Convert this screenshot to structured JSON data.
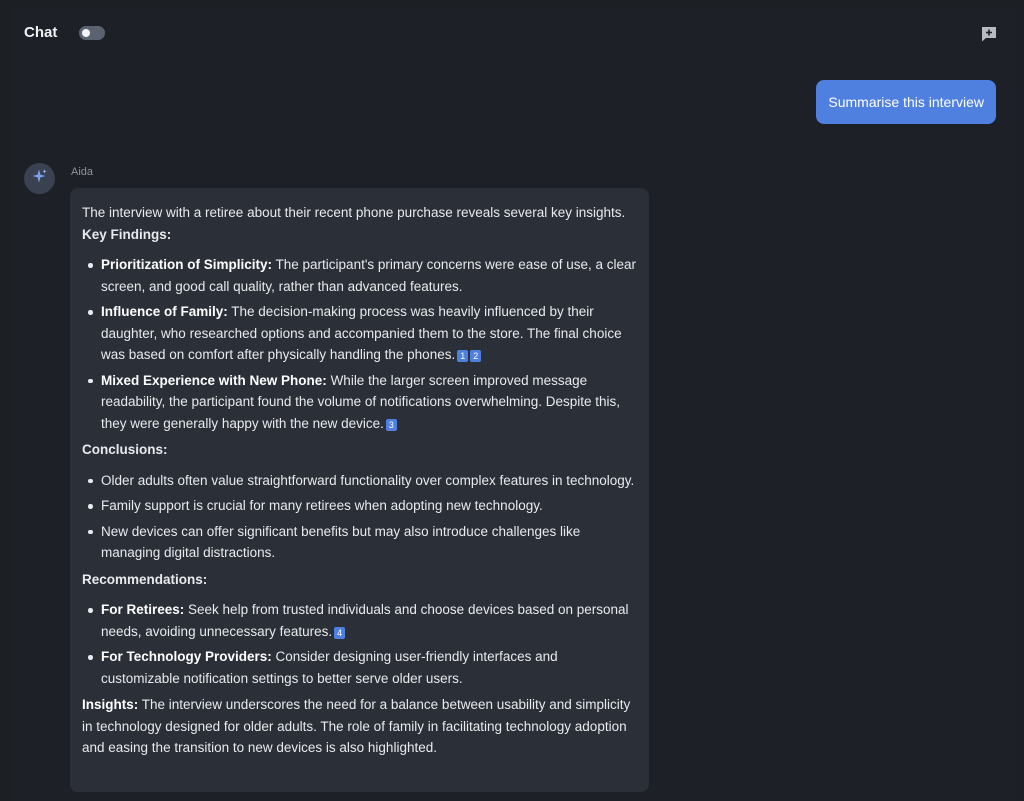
{
  "header": {
    "title": "Chat"
  },
  "user_message": "Summarise this interview",
  "assistant": {
    "name": "Aida",
    "intro": "The interview with a retiree about their recent phone purchase reveals several key insights.",
    "key_findings_title": "Key Findings:",
    "key_findings": [
      {
        "title": "Prioritization of Simplicity:",
        "text": " The participant's primary concerns were ease of use, a clear screen, and good call quality, rather than advanced features.",
        "citations": []
      },
      {
        "title": "Influence of Family:",
        "text": " The decision-making process was heavily influenced by their daughter, who researched options and accompanied them to the store. The final choice was based on comfort after physically handling the phones.",
        "citations": [
          "1",
          "2"
        ]
      },
      {
        "title": "Mixed Experience with New Phone:",
        "text": " While the larger screen improved message readability, the participant found the volume of notifications overwhelming. Despite this, they were generally happy with the new device.",
        "citations": [
          "3"
        ]
      }
    ],
    "conclusions_title": "Conclusions:",
    "conclusions": [
      "Older adults often value straightforward functionality over complex features in technology.",
      "Family support is crucial for many retirees when adopting new technology.",
      "New devices can offer significant benefits but may also introduce challenges like managing digital distractions."
    ],
    "recommendations_title": "Recommendations:",
    "recommendations": [
      {
        "title": "For Retirees:",
        "text": " Seek help from trusted individuals and choose devices based on personal needs, avoiding unnecessary features.",
        "citations": [
          "4"
        ]
      },
      {
        "title": "For Technology Providers:",
        "text": " Consider designing user-friendly interfaces and customizable notification settings to better serve older users.",
        "citations": []
      }
    ],
    "insights_title": "Insights:",
    "insights_text": " The interview underscores the need for a balance between usability and simplicity in technology designed for older adults. The role of family in facilitating technology adoption and easing the transition to new devices is also highlighted."
  },
  "colors": {
    "accent": "#4f7fdf",
    "bubble": "#2b2f37",
    "background": "#1d2026"
  },
  "icons": {
    "toggle": "toggle-switch",
    "new_chat": "new-chat-icon",
    "avatar": "sparkle-icon"
  }
}
